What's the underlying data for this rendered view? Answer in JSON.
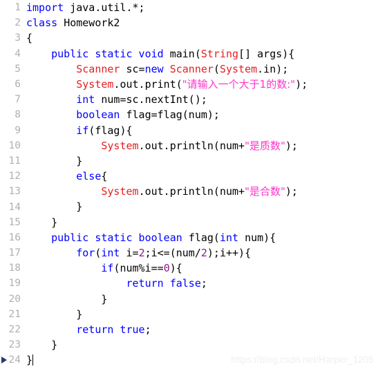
{
  "editor": {
    "language": "java",
    "background_color": "#ffffff",
    "gutter_color": "#b0b0b0",
    "colors": {
      "keyword": "#0000ff",
      "type": "#e32020",
      "string": "#ff33cc",
      "number": "#8b1a8b",
      "plain": "#000000",
      "marker": "#1f3a6e",
      "watermark": "#efefef"
    },
    "current_line": 24,
    "total_lines": 24
  },
  "watermark": {
    "text": "https://blog.csdn.net/Harper_1205"
  },
  "lines": [
    {
      "number": "1",
      "marker": false,
      "caret": false,
      "tokens": [
        {
          "t": "import ",
          "c": "kw"
        },
        {
          "t": "java.util.*;",
          "c": "plain"
        }
      ]
    },
    {
      "number": "2",
      "marker": false,
      "caret": false,
      "tokens": [
        {
          "t": "class ",
          "c": "kw"
        },
        {
          "t": "Homework2",
          "c": "plain"
        }
      ]
    },
    {
      "number": "3",
      "marker": false,
      "caret": false,
      "tokens": [
        {
          "t": "{",
          "c": "plain"
        }
      ]
    },
    {
      "number": "4",
      "marker": false,
      "caret": false,
      "tokens": [
        {
          "t": "    ",
          "c": "plain"
        },
        {
          "t": "public static void ",
          "c": "kw"
        },
        {
          "t": "main(",
          "c": "plain"
        },
        {
          "t": "String",
          "c": "type"
        },
        {
          "t": "[] args){",
          "c": "plain"
        }
      ]
    },
    {
      "number": "5",
      "marker": false,
      "caret": false,
      "tokens": [
        {
          "t": "        ",
          "c": "plain"
        },
        {
          "t": "Scanner",
          "c": "type"
        },
        {
          "t": " sc=",
          "c": "plain"
        },
        {
          "t": "new ",
          "c": "kw"
        },
        {
          "t": "Scanner",
          "c": "type"
        },
        {
          "t": "(",
          "c": "plain"
        },
        {
          "t": "System",
          "c": "type"
        },
        {
          "t": ".in);",
          "c": "plain"
        }
      ]
    },
    {
      "number": "6",
      "marker": false,
      "caret": false,
      "tokens": [
        {
          "t": "        ",
          "c": "plain"
        },
        {
          "t": "System",
          "c": "type"
        },
        {
          "t": ".out.print(",
          "c": "plain"
        },
        {
          "t": "\"请输入一个大于1的数:\"",
          "c": "str"
        },
        {
          "t": ");",
          "c": "plain"
        }
      ]
    },
    {
      "number": "7",
      "marker": false,
      "caret": false,
      "tokens": [
        {
          "t": "        ",
          "c": "plain"
        },
        {
          "t": "int ",
          "c": "kw"
        },
        {
          "t": "num=sc.nextInt();",
          "c": "plain"
        }
      ]
    },
    {
      "number": "8",
      "marker": false,
      "caret": false,
      "tokens": [
        {
          "t": "        ",
          "c": "plain"
        },
        {
          "t": "boolean ",
          "c": "kw"
        },
        {
          "t": "flag=flag(num);",
          "c": "plain"
        }
      ]
    },
    {
      "number": "9",
      "marker": false,
      "caret": false,
      "tokens": [
        {
          "t": "        ",
          "c": "plain"
        },
        {
          "t": "if",
          "c": "kw"
        },
        {
          "t": "(flag){",
          "c": "plain"
        }
      ]
    },
    {
      "number": "10",
      "marker": false,
      "caret": false,
      "tokens": [
        {
          "t": "            ",
          "c": "plain"
        },
        {
          "t": "System",
          "c": "type"
        },
        {
          "t": ".out.println(num+",
          "c": "plain"
        },
        {
          "t": "\"是质数\"",
          "c": "str"
        },
        {
          "t": ");",
          "c": "plain"
        }
      ]
    },
    {
      "number": "11",
      "marker": false,
      "caret": false,
      "tokens": [
        {
          "t": "        }",
          "c": "plain"
        }
      ]
    },
    {
      "number": "12",
      "marker": false,
      "caret": false,
      "tokens": [
        {
          "t": "        ",
          "c": "plain"
        },
        {
          "t": "else",
          "c": "kw"
        },
        {
          "t": "{",
          "c": "plain"
        }
      ]
    },
    {
      "number": "13",
      "marker": false,
      "caret": false,
      "tokens": [
        {
          "t": "            ",
          "c": "plain"
        },
        {
          "t": "System",
          "c": "type"
        },
        {
          "t": ".out.println(num+",
          "c": "plain"
        },
        {
          "t": "\"是合数\"",
          "c": "str"
        },
        {
          "t": ");",
          "c": "plain"
        }
      ]
    },
    {
      "number": "14",
      "marker": false,
      "caret": false,
      "tokens": [
        {
          "t": "        }",
          "c": "plain"
        }
      ]
    },
    {
      "number": "15",
      "marker": false,
      "caret": false,
      "tokens": [
        {
          "t": "    }",
          "c": "plain"
        }
      ]
    },
    {
      "number": "16",
      "marker": false,
      "caret": false,
      "tokens": [
        {
          "t": "    ",
          "c": "plain"
        },
        {
          "t": "public static boolean ",
          "c": "kw"
        },
        {
          "t": "flag(",
          "c": "plain"
        },
        {
          "t": "int ",
          "c": "kw"
        },
        {
          "t": "num){",
          "c": "plain"
        }
      ]
    },
    {
      "number": "17",
      "marker": false,
      "caret": false,
      "tokens": [
        {
          "t": "        ",
          "c": "plain"
        },
        {
          "t": "for",
          "c": "kw"
        },
        {
          "t": "(",
          "c": "plain"
        },
        {
          "t": "int ",
          "c": "kw"
        },
        {
          "t": "i=",
          "c": "plain"
        },
        {
          "t": "2",
          "c": "num"
        },
        {
          "t": ";i<=(num/",
          "c": "plain"
        },
        {
          "t": "2",
          "c": "num"
        },
        {
          "t": ");i++){",
          "c": "plain"
        }
      ]
    },
    {
      "number": "18",
      "marker": false,
      "caret": false,
      "tokens": [
        {
          "t": "            ",
          "c": "plain"
        },
        {
          "t": "if",
          "c": "kw"
        },
        {
          "t": "(num%i==",
          "c": "plain"
        },
        {
          "t": "0",
          "c": "num"
        },
        {
          "t": "){",
          "c": "plain"
        }
      ]
    },
    {
      "number": "19",
      "marker": false,
      "caret": false,
      "tokens": [
        {
          "t": "                ",
          "c": "plain"
        },
        {
          "t": "return false",
          "c": "kw"
        },
        {
          "t": ";",
          "c": "plain"
        }
      ]
    },
    {
      "number": "20",
      "marker": false,
      "caret": false,
      "tokens": [
        {
          "t": "            }",
          "c": "plain"
        }
      ]
    },
    {
      "number": "21",
      "marker": false,
      "caret": false,
      "tokens": [
        {
          "t": "        }",
          "c": "plain"
        }
      ]
    },
    {
      "number": "22",
      "marker": false,
      "caret": false,
      "tokens": [
        {
          "t": "        ",
          "c": "plain"
        },
        {
          "t": "return true",
          "c": "kw"
        },
        {
          "t": ";",
          "c": "plain"
        }
      ]
    },
    {
      "number": "23",
      "marker": false,
      "caret": false,
      "tokens": [
        {
          "t": "    }",
          "c": "plain"
        }
      ]
    },
    {
      "number": "24",
      "marker": true,
      "caret": true,
      "tokens": [
        {
          "t": "}",
          "c": "plain"
        }
      ]
    }
  ]
}
